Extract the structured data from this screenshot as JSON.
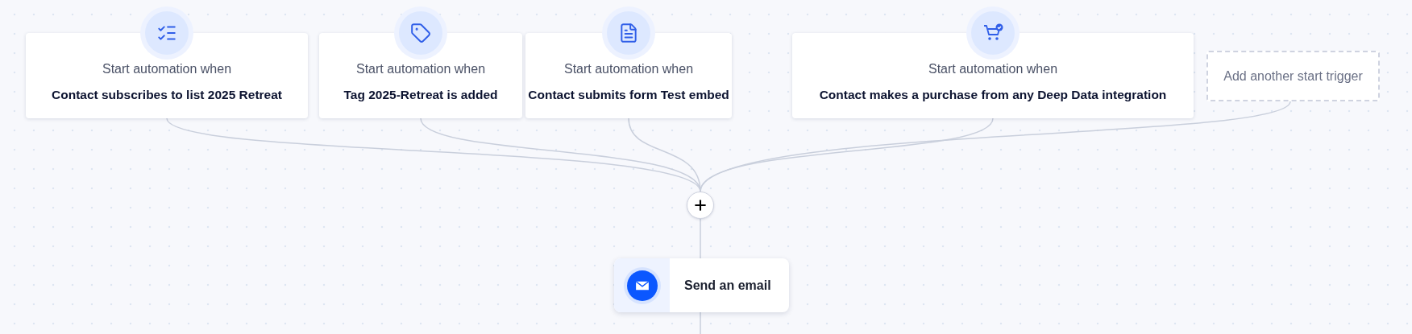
{
  "triggers": [
    {
      "kind": "list",
      "caption": "Start automation when",
      "condition": "Contact subscribes to list 2025 Retreat"
    },
    {
      "kind": "tag",
      "caption": "Start automation when",
      "condition": "Tag 2025-Retreat is added"
    },
    {
      "kind": "form",
      "caption": "Start automation when",
      "condition": "Contact submits form Test embed"
    },
    {
      "kind": "purchase",
      "caption": "Start automation when",
      "condition": "Contact makes a purchase from any Deep Data integration"
    }
  ],
  "add_trigger": {
    "label": "Add another start trigger"
  },
  "actions": [
    {
      "kind": "email",
      "label": "Send an email"
    }
  ]
}
